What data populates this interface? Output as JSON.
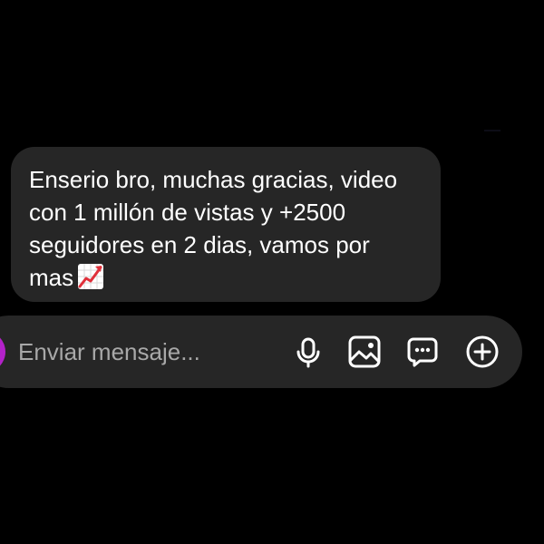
{
  "message": {
    "lines": [
      "Enserio bro, muchas gracias, video",
      "con 1 millón de vistas y +2500",
      "seguidores en 2 dias, vamos por",
      "mas"
    ],
    "emoji": "chart-increasing-emoji"
  },
  "composer": {
    "placeholder": "Enviar mensaje...",
    "icons": [
      "microphone-icon",
      "gallery-icon",
      "sticker-icon",
      "plus-icon"
    ],
    "camera_color": "#b322c9"
  },
  "colors": {
    "background": "#000000",
    "bubble": "#262626",
    "text": "#ffffff",
    "placeholder": "#a8a8a8",
    "emoji_red": "#e0303a"
  }
}
